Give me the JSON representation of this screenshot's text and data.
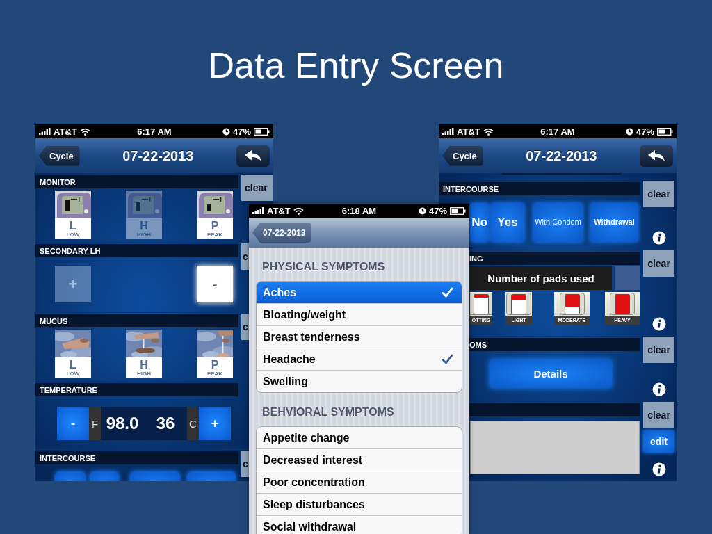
{
  "slide": {
    "title": "Data Entry Screen"
  },
  "left_phone": {
    "status_bar": {
      "carrier": "AT&T",
      "time": "6:17 AM",
      "battery": "47%"
    },
    "nav_bar": {
      "kind": "dark",
      "back_button": "Cycle",
      "title": "07-22-2013"
    },
    "monitor": {
      "heading": "MONITOR",
      "clear_button": "clear",
      "options": [
        {
          "letter": "L",
          "label": "LOW",
          "dimmed": false
        },
        {
          "letter": "H",
          "label": "HIGH",
          "dimmed": true
        },
        {
          "letter": "P",
          "label": "PEAK",
          "dimmed": false
        }
      ]
    },
    "secondary_lh": {
      "heading": "SECONDARY LH",
      "clear_button": "c",
      "buttons": [
        {
          "symbol": "+",
          "dimmed": true
        },
        {
          "symbol": "-",
          "dimmed": false
        }
      ]
    },
    "mucus": {
      "heading": "MUCUS",
      "clear_button": "c",
      "options": [
        {
          "letter": "L",
          "label": "LOW"
        },
        {
          "letter": "H",
          "label": "HIGH"
        },
        {
          "letter": "P",
          "label": "PEAK"
        }
      ]
    },
    "temperature": {
      "heading": "TEMPERATURE",
      "minus_button": "-",
      "fahrenheit_unit": "F",
      "fahrenheit_value": "98.0",
      "celsius_value": "36",
      "celsius_unit": "C",
      "plus_button": "+"
    },
    "intercourse": {
      "heading": "INTERCOURSE",
      "clear_button": "c"
    }
  },
  "symptoms_phone": {
    "status_bar": {
      "carrier": "AT&T",
      "time": "6:18 AM",
      "battery": "47%"
    },
    "nav_bar": {
      "kind": "light",
      "back_button": "07-22-2013"
    },
    "sections": [
      {
        "heading": "PHYSICAL SYMPTOMS",
        "items": [
          {
            "label": "Aches",
            "selected": true,
            "checked": true
          },
          {
            "label": "Bloating/weight",
            "selected": false,
            "checked": false
          },
          {
            "label": "Breast tenderness",
            "selected": false,
            "checked": false
          },
          {
            "label": "Headache",
            "selected": false,
            "checked": true
          },
          {
            "label": "Swelling",
            "selected": false,
            "checked": false
          }
        ]
      },
      {
        "heading": "BEHVIORAL SYMPTOMS",
        "items": [
          {
            "label": "Appetite change",
            "selected": false,
            "checked": false
          },
          {
            "label": "Decreased interest",
            "selected": false,
            "checked": false
          },
          {
            "label": "Poor concentration",
            "selected": false,
            "checked": false
          },
          {
            "label": "Sleep disturbances",
            "selected": false,
            "checked": false
          },
          {
            "label": "Social withdrawal",
            "selected": false,
            "checked": false
          }
        ]
      }
    ]
  },
  "right_phone": {
    "status_bar": {
      "carrier": "AT&T",
      "time": "6:17 AM",
      "battery": "47%"
    },
    "nav_bar": {
      "kind": "dark",
      "back_button": "Cycle",
      "title": "07-22-2013"
    },
    "intercourse": {
      "heading": "INTERCOURSE",
      "clear_button": "clear",
      "options": [
        {
          "label": "No"
        },
        {
          "label": "Yes"
        },
        {
          "label": "With Condom"
        },
        {
          "label": "Withdrawal"
        }
      ]
    },
    "bleeding": {
      "heading": "ING",
      "clear_button": "clear",
      "pads_label": "Number of pads used",
      "flow_options": [
        {
          "label": "OTTING",
          "level": 0.15
        },
        {
          "label": "LIGHT",
          "level": 0.3
        },
        {
          "label": "MODERATE",
          "level": 0.65
        },
        {
          "label": "HEAVY",
          "level": 1
        }
      ]
    },
    "symptoms": {
      "heading": "OMS",
      "clear_button": "clear",
      "details_button": "Details"
    },
    "notes": {
      "clear_button": "clear",
      "edit_button": "edit"
    }
  }
}
